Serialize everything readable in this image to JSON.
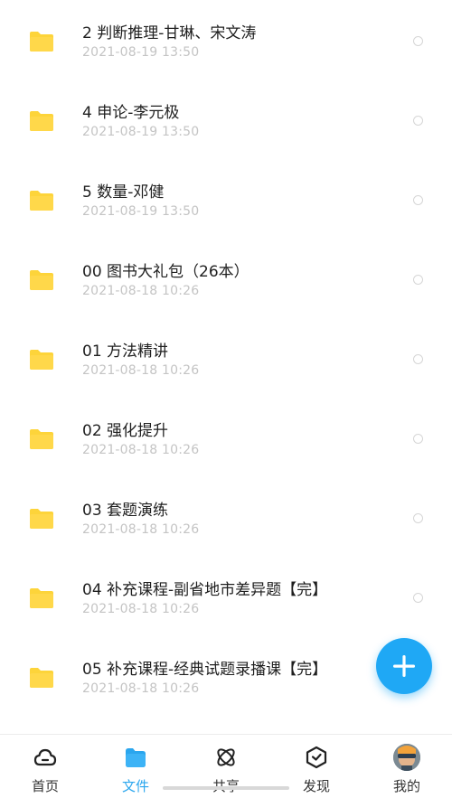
{
  "files": [
    {
      "name": "2 判断推理-甘琳、宋文涛",
      "date": "2021-08-19  13:50"
    },
    {
      "name": "4 申论-李元极",
      "date": "2021-08-19  13:50"
    },
    {
      "name": "5 数量-邓健",
      "date": "2021-08-19  13:50"
    },
    {
      "name": "00 图书大礼包（26本）",
      "date": "2021-08-18  10:26"
    },
    {
      "name": "01 方法精讲",
      "date": "2021-08-18  10:26"
    },
    {
      "name": "02 强化提升",
      "date": "2021-08-18  10:26"
    },
    {
      "name": "03 套题演练",
      "date": "2021-08-18  10:26"
    },
    {
      "name": "04 补充课程-副省地市差异题【完】",
      "date": "2021-08-18  10:26"
    },
    {
      "name": "05 补充课程-经典试题录播课【完】",
      "date": "2021-08-18  10:26"
    }
  ],
  "tabs": [
    {
      "label": "首页",
      "icon": "cloud-icon"
    },
    {
      "label": "文件",
      "icon": "folder-icon",
      "active": true
    },
    {
      "label": "共享",
      "icon": "share-atom-icon"
    },
    {
      "label": "发现",
      "icon": "discover-box-icon"
    },
    {
      "label": "我的",
      "icon": "avatar"
    }
  ],
  "colors": {
    "accent": "#2aa6ee",
    "fab": "#1fa8f5",
    "folder": "#fdd43a",
    "date_text": "#c4c4c4",
    "name_text": "#1f1f1f"
  },
  "fab": {
    "icon": "plus-icon"
  }
}
